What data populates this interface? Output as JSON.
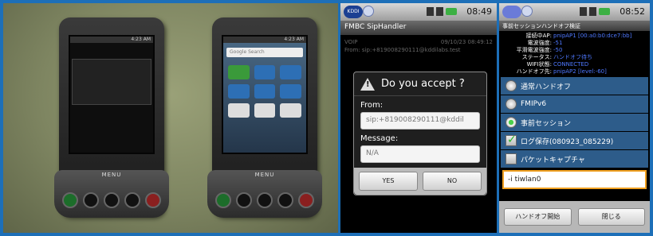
{
  "photo": {
    "phone1": {
      "time": "4:23 AM",
      "menu_label": "MENU"
    },
    "phone2": {
      "time": "4:23 AM",
      "search_placeholder": "Google Search",
      "menu_label": "MENU"
    }
  },
  "screen_accept": {
    "carrier_logo": "KDDI",
    "time": "08:49",
    "app_title": "FMBC SipHandler",
    "bg_line1_left": "VOIP",
    "bg_line1_right": "09/10/23 08:49:12",
    "bg_line2": "From: sip:+819008290111@kddilabs.test",
    "dialog": {
      "title": "Do you accept ?",
      "from_label": "From:",
      "from_value": "sip:+819008290111@kddil",
      "message_label": "Message:",
      "message_value": "N/A",
      "yes_label": "YES",
      "no_label": "NO"
    }
  },
  "screen_handoff": {
    "time": "08:52",
    "title": "事前セッションハンドオフ検証",
    "info": [
      {
        "key": "接続中AP:",
        "value": "pnipAP1 [00:a0:b0:dce7:bb]"
      },
      {
        "key": "電波強度:",
        "value": "-51"
      },
      {
        "key": "平滑電波強度:",
        "value": "-50"
      },
      {
        "key": "ステータス:",
        "value": "ハンドオフ待ち"
      },
      {
        "key": "WIFI状態:",
        "value": "CONNECTED"
      },
      {
        "key": "ハンドオフ先:",
        "value": "pnipAP2 [level:-60]"
      }
    ],
    "options": {
      "normal": "通常ハンドオフ",
      "fmipv6": "FMIPv6",
      "advance": "事前セッション",
      "log_save": "ログ保存(080923_085229)",
      "packet_capture": "パケットキャプチャ"
    },
    "interface_value": "-i tiwlan0",
    "start_button": "ハンドオフ開始",
    "close_button": "閉じる"
  }
}
